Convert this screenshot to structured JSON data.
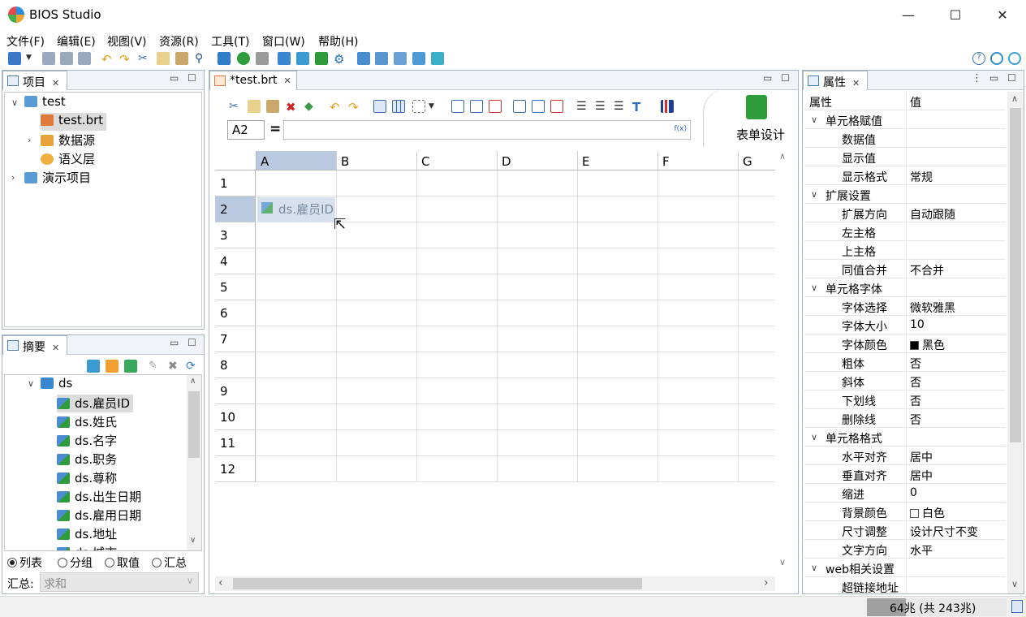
{
  "app": {
    "title": "BIOS Studio"
  },
  "window_controls": {
    "minimize": "—",
    "maximize": "☐",
    "close": "✕"
  },
  "menu": [
    "文件(F)",
    "编辑(E)",
    "视图(V)",
    "资源(R)",
    "工具(T)",
    "窗口(W)",
    "帮助(H)"
  ],
  "project_panel": {
    "tab": "项目",
    "tree": [
      {
        "label": "test",
        "level": 0,
        "expanded": true
      },
      {
        "label": "test.brt",
        "level": 1,
        "selected": true
      },
      {
        "label": "数据源",
        "level": 1,
        "expanded": false
      },
      {
        "label": "语义层",
        "level": 1
      },
      {
        "label": "演示项目",
        "level": 0,
        "expanded": false
      }
    ]
  },
  "summary_panel": {
    "tab": "摘要",
    "root": "ds",
    "fields": [
      "ds.雇员ID",
      "ds.姓氏",
      "ds.名字",
      "ds.职务",
      "ds.尊称",
      "ds.出生日期",
      "ds.雇用日期",
      "ds.地址",
      "ds.城市"
    ],
    "selected_field": "ds.雇员ID",
    "modes": [
      "列表",
      "分组",
      "取值",
      "汇总"
    ],
    "active_mode": "列表",
    "aggregate_label": "汇总:",
    "aggregate_value": "求和"
  },
  "editor": {
    "tab": "*test.brt",
    "cell_ref": "A2",
    "equals": "=",
    "formula": "",
    "fx": "f(x)",
    "design_label": "表单设计",
    "columns": [
      "A",
      "B",
      "C",
      "D",
      "E",
      "F",
      "G"
    ],
    "rows": [
      "1",
      "2",
      "3",
      "4",
      "5",
      "6",
      "7",
      "8",
      "9",
      "10",
      "11",
      "12"
    ],
    "cell_A2": "ds.雇员ID"
  },
  "properties_panel": {
    "tab": "属性",
    "header_key": "属性",
    "header_value": "值",
    "rows": [
      {
        "k": "单元格赋值",
        "group": true
      },
      {
        "k": "数据值",
        "v": ""
      },
      {
        "k": "显示值",
        "v": ""
      },
      {
        "k": "显示格式",
        "v": "常规"
      },
      {
        "k": "扩展设置",
        "group": true
      },
      {
        "k": "扩展方向",
        "v": "自动跟随"
      },
      {
        "k": "左主格",
        "v": ""
      },
      {
        "k": "上主格",
        "v": ""
      },
      {
        "k": "同值合并",
        "v": "不合并"
      },
      {
        "k": "单元格字体",
        "group": true
      },
      {
        "k": "字体选择",
        "v": "微软雅黑"
      },
      {
        "k": "字体大小",
        "v": "10"
      },
      {
        "k": "字体颜色",
        "v": "黑色",
        "swatch": "#000000"
      },
      {
        "k": "粗体",
        "v": "否"
      },
      {
        "k": "斜体",
        "v": "否"
      },
      {
        "k": "下划线",
        "v": "否"
      },
      {
        "k": "删除线",
        "v": "否"
      },
      {
        "k": "单元格格式",
        "group": true
      },
      {
        "k": "水平对齐",
        "v": "居中"
      },
      {
        "k": "垂直对齐",
        "v": "居中"
      },
      {
        "k": "缩进",
        "v": "0"
      },
      {
        "k": "背景颜色",
        "v": "白色",
        "swatch": "#ffffff"
      },
      {
        "k": "尺寸调整",
        "v": "设计尺寸不变"
      },
      {
        "k": "文字方向",
        "v": "水平"
      },
      {
        "k": "web相关设置",
        "group": true
      },
      {
        "k": "超链接地址",
        "v": ""
      }
    ]
  },
  "status": {
    "memory": "64兆 (共 243兆)"
  },
  "colors": {
    "selection": "#b9c9e0",
    "tab_bg": "#f0f3f8",
    "border": "#aab3c0",
    "accent_green": "#2e9c3a"
  }
}
